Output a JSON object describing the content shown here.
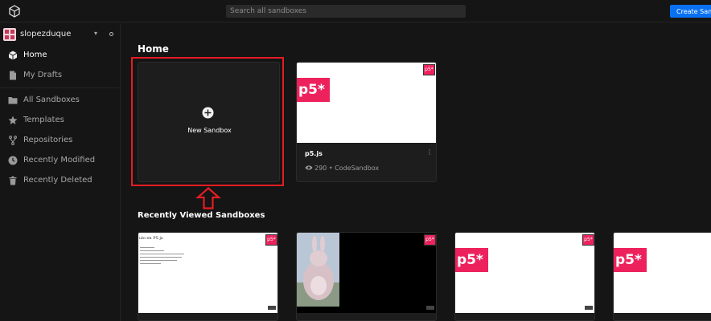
{
  "topbar": {
    "logo_icon": "codesandbox-cube-icon",
    "search_placeholder": "Search all sandboxes",
    "create_label": "Create Sandbox"
  },
  "sidebar": {
    "username": "slopezduque",
    "items": [
      {
        "label": "Home",
        "icon": "cube-icon",
        "active": true
      },
      {
        "label": "My Drafts",
        "icon": "document-icon"
      },
      {
        "label": "All Sandboxes",
        "icon": "folder-icon"
      },
      {
        "label": "Templates",
        "icon": "star-icon"
      },
      {
        "label": "Repositories",
        "icon": "branch-icon"
      },
      {
        "label": "Recently Modified",
        "icon": "clock-icon"
      },
      {
        "label": "Recently Deleted",
        "icon": "trash-icon"
      }
    ]
  },
  "main": {
    "home_title": "Home",
    "new_sandbox_label": "New Sandbox",
    "featured": {
      "title": "p5.js",
      "views": "290",
      "author": "CodeSandbox",
      "badge": "p5*"
    },
    "recent_title": "Recently Viewed Sandboxes",
    "recent_first_heading": "ulo en P5.js",
    "p5_badge": "p5*"
  },
  "colors": {
    "accent": "#0971f1",
    "p5_pink": "#ed225d",
    "highlight_red": "#e51c23"
  }
}
